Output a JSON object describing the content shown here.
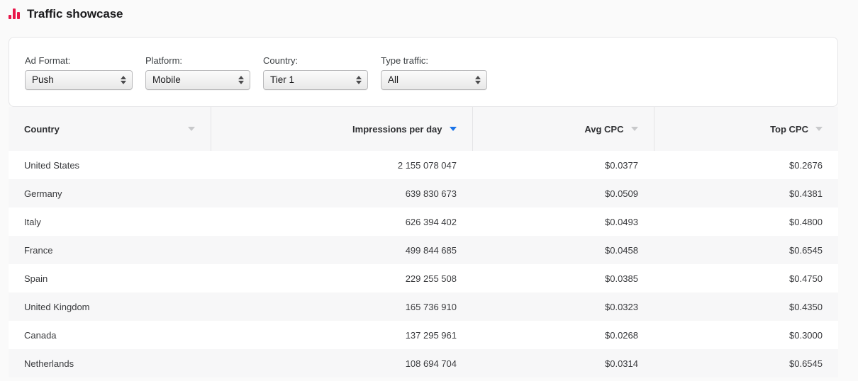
{
  "header": {
    "icon": "bar-chart-icon",
    "title": "Traffic showcase"
  },
  "filters": [
    {
      "label": "Ad Format:",
      "value": "Push",
      "name": "ad-format"
    },
    {
      "label": "Platform:",
      "value": "Mobile",
      "name": "platform"
    },
    {
      "label": "Country:",
      "value": "Tier 1",
      "name": "country"
    },
    {
      "label": "Type traffic:",
      "value": "All",
      "name": "type-traffic"
    }
  ],
  "table": {
    "columns": [
      {
        "label": "Country",
        "align": "left",
        "sorted": false,
        "sort_dir": "desc"
      },
      {
        "label": "Impressions per day",
        "align": "right",
        "sorted": true,
        "sort_dir": "desc"
      },
      {
        "label": "Avg CPC",
        "align": "right",
        "sorted": false,
        "sort_dir": "desc"
      },
      {
        "label": "Top CPC",
        "align": "right",
        "sorted": false,
        "sort_dir": "desc"
      }
    ],
    "rows": [
      {
        "country": "United States",
        "impressions": "2 155 078 047",
        "avg_cpc": "$0.0377",
        "top_cpc": "$0.2676"
      },
      {
        "country": "Germany",
        "impressions": "639 830 673",
        "avg_cpc": "$0.0509",
        "top_cpc": "$0.4381"
      },
      {
        "country": "Italy",
        "impressions": "626 394 402",
        "avg_cpc": "$0.0493",
        "top_cpc": "$0.4800"
      },
      {
        "country": "France",
        "impressions": "499 844 685",
        "avg_cpc": "$0.0458",
        "top_cpc": "$0.6545"
      },
      {
        "country": "Spain",
        "impressions": "229 255 508",
        "avg_cpc": "$0.0385",
        "top_cpc": "$0.4750"
      },
      {
        "country": "United Kingdom",
        "impressions": "165 736 910",
        "avg_cpc": "$0.0323",
        "top_cpc": "$0.4350"
      },
      {
        "country": "Canada",
        "impressions": "137 295 961",
        "avg_cpc": "$0.0268",
        "top_cpc": "$0.3000"
      },
      {
        "country": "Netherlands",
        "impressions": "108 694 704",
        "avg_cpc": "$0.0314",
        "top_cpc": "$0.6545"
      }
    ]
  },
  "colors": {
    "accent_red": "#e8174a",
    "sort_active_blue": "#1a73e8",
    "page_background": "#fafafa",
    "row_alt_background": "#f7f7f8"
  }
}
